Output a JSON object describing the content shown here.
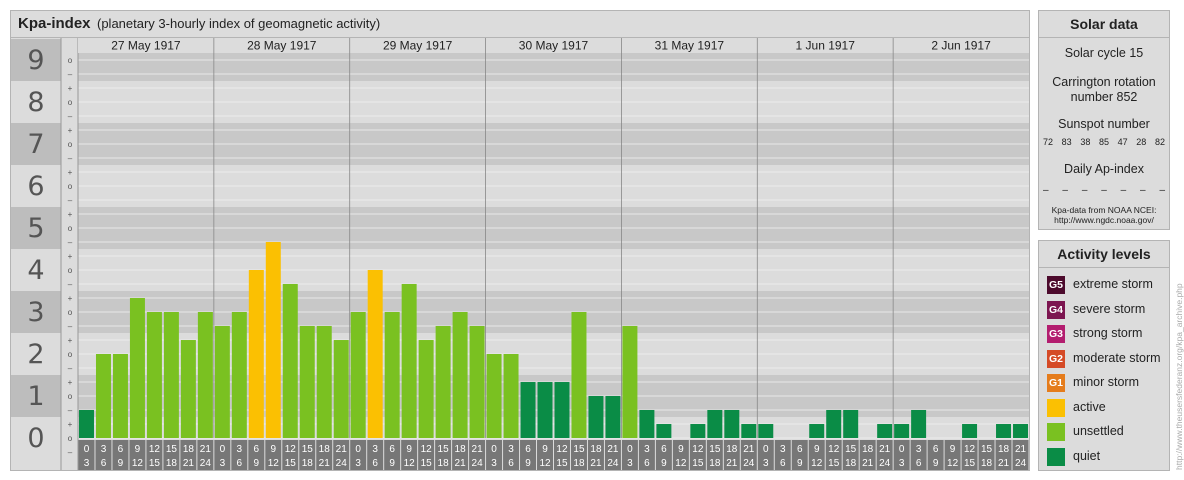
{
  "header": {
    "title": "Kpa-index",
    "subtitle": "(planetary 3-hourly index of geomagnetic activity)"
  },
  "chart_data": {
    "type": "bar",
    "title": "Kpa-index",
    "subtitle": "(planetary 3-hourly index of geomagnetic activity)",
    "ylim": [
      0,
      9
    ],
    "y_ticks": [
      "0",
      "1",
      "2",
      "3",
      "4",
      "5",
      "6",
      "7",
      "8",
      "9"
    ],
    "y_subticks": [
      "+",
      "o",
      "–"
    ],
    "days": [
      "27 May 1917",
      "28 May 1917",
      "29 May 1917",
      "30 May 1917",
      "31 May 1917",
      "1 Jun 1917",
      "2 Jun 1917"
    ],
    "interval_start": [
      "0",
      "3",
      "6",
      "9",
      "12",
      "15",
      "18",
      "21"
    ],
    "interval_end": [
      "3",
      "6",
      "9",
      "12",
      "15",
      "18",
      "21",
      "24"
    ],
    "values": [
      0.667,
      2.0,
      2.0,
      3.333,
      3.0,
      3.0,
      2.333,
      3.0,
      2.667,
      3.0,
      4.0,
      4.667,
      3.667,
      2.667,
      2.667,
      2.333,
      3.0,
      4.0,
      3.0,
      3.667,
      2.333,
      2.667,
      3.0,
      2.667,
      2.0,
      2.0,
      1.333,
      1.333,
      1.333,
      3.0,
      1.0,
      1.0,
      2.667,
      0.667,
      0.333,
      0.0,
      0.333,
      0.667,
      0.667,
      0.333,
      0.333,
      0.0,
      0.0,
      0.333,
      0.667,
      0.667,
      0.0,
      0.333,
      0.333,
      0.667,
      0.0,
      0.0,
      0.333,
      0.0,
      0.333,
      0.333
    ],
    "grid": true
  },
  "colors": {
    "quiet": "#0a8c46",
    "unsettled": "#7ac121",
    "active": "#fbc002",
    "G1": "#e57c1c",
    "G2": "#d54a26",
    "G3": "#b31d6f",
    "G4": "#7c1550",
    "G5": "#4c0a2c",
    "band_dark": "#c8c8c8",
    "band_light": "#dcdcdc",
    "axis_number_bg": "#bdbdbd",
    "hour_cell": "#777777"
  },
  "solar": {
    "title": "Solar data",
    "cycle": "Solar cycle 15",
    "rotation_line1": "Carrington rotation",
    "rotation_line2": "number 852",
    "sunspot_title": "Sunspot number",
    "sunspot_values": [
      "72",
      "83",
      "38",
      "85",
      "47",
      "28",
      "82"
    ],
    "ap_title": "Daily Ap-index",
    "ap_values": [
      "–",
      "–",
      "–",
      "–",
      "–",
      "–",
      "–"
    ],
    "source_line1": "Kpa-data from NOAA NCEI:",
    "source_line2": "http://www.ngdc.noaa.gov/"
  },
  "legend": {
    "title": "Activity levels",
    "items": [
      {
        "code": "G5",
        "label": "extreme storm",
        "icon": "g5-badge",
        "color": "#4c0a2c"
      },
      {
        "code": "G4",
        "label": "severe storm",
        "icon": "g4-badge",
        "color": "#7c1550"
      },
      {
        "code": "G3",
        "label": "strong storm",
        "icon": "g3-badge",
        "color": "#b31d6f"
      },
      {
        "code": "G2",
        "label": "moderate storm",
        "icon": "g2-badge",
        "color": "#d54a26"
      },
      {
        "code": "G1",
        "label": "minor storm",
        "icon": "g1-badge",
        "color": "#e57c1c"
      },
      {
        "code": "",
        "label": "active",
        "icon": "active-swatch",
        "color": "#fbc002"
      },
      {
        "code": "",
        "label": "unsettled",
        "icon": "unsettled-swatch",
        "color": "#7ac121"
      },
      {
        "code": "",
        "label": "quiet",
        "icon": "quiet-swatch",
        "color": "#0a8c46"
      }
    ]
  },
  "watermark": "http://www.theusersfederanz.org/kpa_archive.php"
}
